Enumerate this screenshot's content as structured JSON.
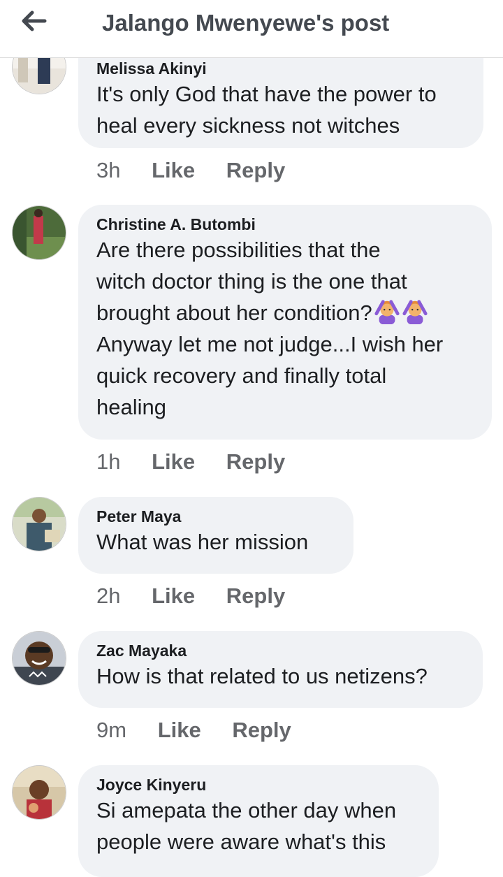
{
  "header": {
    "title": "Jalango Mwenyewe's post"
  },
  "comments": [
    {
      "author": "Melissa Akinyi",
      "text": "It's only God that have the power to\nheal every sickness not witches",
      "time": "3h",
      "like": "Like",
      "reply": "Reply"
    },
    {
      "author": "Christine A. Butombi",
      "text_a": "Are there possibilities that the\nwitch doctor thing is the one that\nbrought about her condition?",
      "text_b": "\nAnyway let me not judge...I wish her\nquick recovery and finally total\nhealing",
      "emoji": [
        "person-gesturing-no-emoji",
        "person-gesturing-no-emoji"
      ],
      "time": "1h",
      "like": "Like",
      "reply": "Reply"
    },
    {
      "author": "Peter Maya",
      "text": "What was her mission",
      "time": "2h",
      "like": "Like",
      "reply": "Reply"
    },
    {
      "author": "Zac Mayaka",
      "text": "How is that related to us netizens?",
      "time": "9m",
      "like": "Like",
      "reply": "Reply"
    },
    {
      "author": "Joyce Kinyeru",
      "text": "Si amepata the other day when\npeople were aware what's this",
      "time": "",
      "like": "",
      "reply": ""
    }
  ]
}
